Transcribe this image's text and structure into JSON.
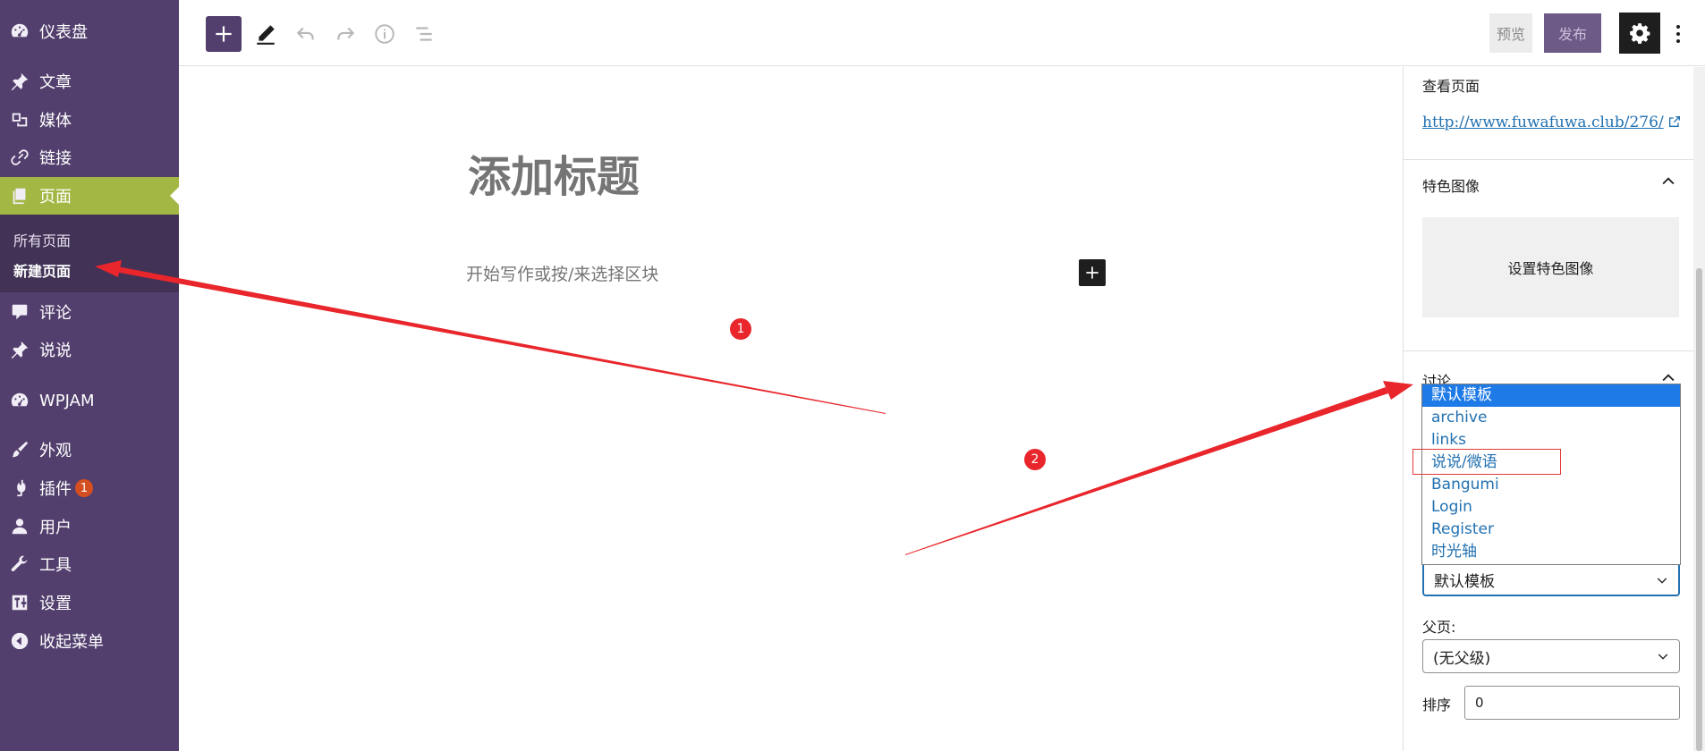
{
  "sidebar": {
    "items": [
      {
        "label": "仪表盘",
        "icon": "dashboard-icon"
      },
      {
        "label": "文章",
        "icon": "pin-icon"
      },
      {
        "label": "媒体",
        "icon": "media-icon"
      },
      {
        "label": "链接",
        "icon": "link-icon"
      },
      {
        "label": "页面",
        "icon": "pages-icon"
      },
      {
        "label": "评论",
        "icon": "comment-icon"
      },
      {
        "label": "说说",
        "icon": "pin-icon"
      },
      {
        "label": "WPJAM",
        "icon": "dashboard-icon"
      },
      {
        "label": "外观",
        "icon": "brush-icon"
      },
      {
        "label": "插件",
        "icon": "plugin-icon",
        "badge": "1"
      },
      {
        "label": "用户",
        "icon": "user-icon"
      },
      {
        "label": "工具",
        "icon": "wrench-icon"
      },
      {
        "label": "设置",
        "icon": "settings-sliders-icon"
      },
      {
        "label": "收起菜单",
        "icon": "collapse-icon"
      }
    ],
    "pages_submenu": [
      "所有页面",
      "新建页面"
    ]
  },
  "toolbar": {
    "preview": "预览",
    "publish": "发布",
    "icons": [
      "add-block-icon",
      "edit-pen-icon",
      "undo-icon",
      "redo-icon",
      "info-icon",
      "list-view-icon",
      "gear-icon",
      "more-vertical-icon"
    ]
  },
  "editor": {
    "title_placeholder": "添加标题",
    "body_placeholder": "开始写作或按/来选择区块"
  },
  "settings": {
    "view_page_label": "查看页面",
    "page_url": "http://www.fuwafuwa.club/276/",
    "featured_image_label": "特色图像",
    "set_featured_image": "设置特色图像",
    "discussion_label": "讨论",
    "template_value": "默认模板",
    "template_options": [
      "默认模板",
      "archive",
      "links",
      "说说/微语",
      "Bangumi",
      "Login",
      "Register",
      "时光轴"
    ],
    "parent_label": "父页:",
    "parent_value": "(无父级)",
    "order_label": "排序",
    "order_value": "0"
  },
  "annotations": {
    "marker_1": "1",
    "marker_2": "2"
  },
  "colors": {
    "sidebar_bg": "#523f6d",
    "active_item": "#a3b745",
    "accent": "#2271b1",
    "annotation_red": "#e8262b"
  }
}
